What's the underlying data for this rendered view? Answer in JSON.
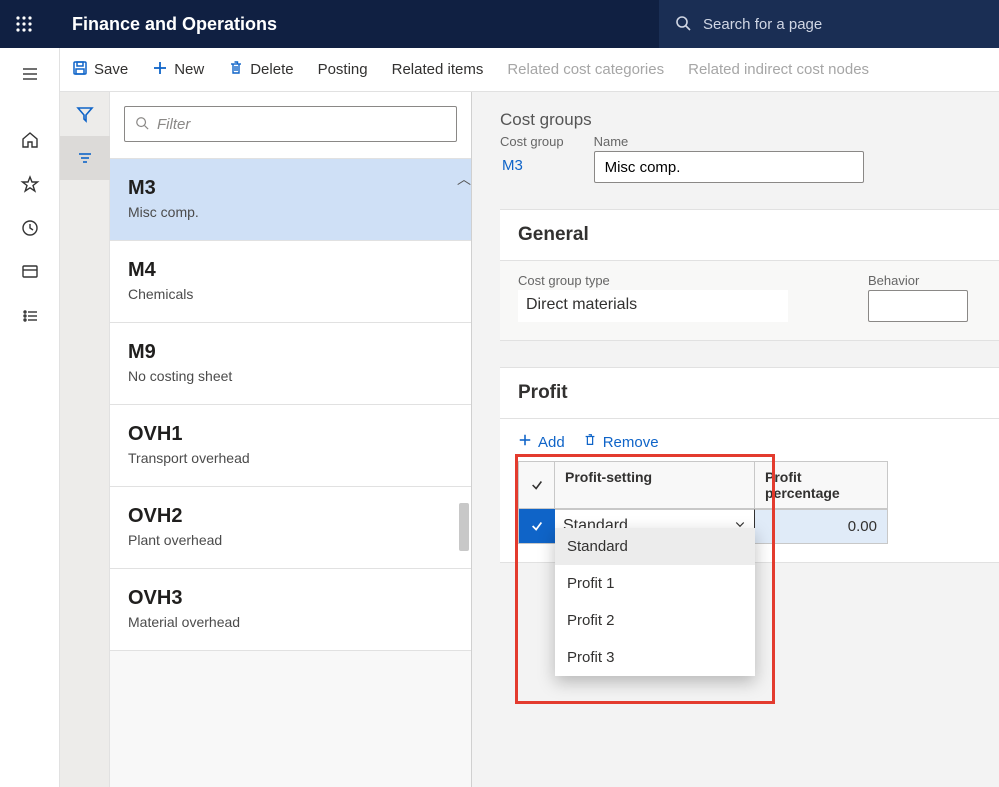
{
  "header": {
    "app_title": "Finance and Operations",
    "search_placeholder": "Search for a page"
  },
  "actions": {
    "save": "Save",
    "new": "New",
    "delete": "Delete",
    "posting": "Posting",
    "related_items": "Related items",
    "related_cost_categories": "Related cost categories",
    "related_indirect_cost_nodes": "Related indirect cost nodes"
  },
  "list": {
    "filter_placeholder": "Filter",
    "items": [
      {
        "code": "M3",
        "name": "Misc comp."
      },
      {
        "code": "M4",
        "name": "Chemicals"
      },
      {
        "code": "M9",
        "name": "No costing sheet"
      },
      {
        "code": "OVH1",
        "name": "Transport overhead"
      },
      {
        "code": "OVH2",
        "name": "Plant overhead"
      },
      {
        "code": "OVH3",
        "name": "Material overhead"
      }
    ]
  },
  "detail": {
    "page_title": "Cost groups",
    "cost_group_label": "Cost group",
    "cost_group_value": "M3",
    "name_label": "Name",
    "name_value": "Misc comp.",
    "general": {
      "title": "General",
      "cost_group_type_label": "Cost group type",
      "cost_group_type_value": "Direct materials",
      "behavior_label": "Behavior",
      "behavior_value": ""
    },
    "profit": {
      "title": "Profit",
      "add": "Add",
      "remove": "Remove",
      "col_profit_setting": "Profit-setting",
      "col_profit_percentage": "Profit percentage",
      "row_setting_value": "Standard",
      "row_percentage_value": "0.00",
      "options": [
        "Standard",
        "Profit 1",
        "Profit 2",
        "Profit 3"
      ]
    }
  }
}
